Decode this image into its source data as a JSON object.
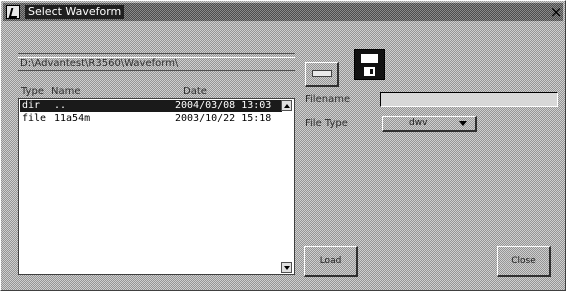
{
  "window": {
    "title": "Select Waveform",
    "close_glyph": "×"
  },
  "path": "D:\\Advantest\\R3560\\Waveform\\",
  "file_list": {
    "columns": [
      "Type",
      "Name",
      "Date"
    ],
    "rows": [
      {
        "type": "dir",
        "name": "..",
        "date": "2004/03/08 13:03",
        "selected": true
      },
      {
        "type": "file",
        "name": "11a54m",
        "date": "2003/10/22 15:18",
        "selected": false
      }
    ]
  },
  "icons": {
    "up_folder": "up-folder-icon",
    "save": "floppy-disk-icon",
    "scroll_up": "scroll-up-arrow-icon",
    "scroll_down": "scroll-down-arrow-icon"
  },
  "filename": {
    "label": "Filename",
    "value": ""
  },
  "filetype": {
    "label": "File Type",
    "value": "dwv"
  },
  "buttons": {
    "load": "Load",
    "close": "Close"
  },
  "colors": {
    "selection": "#1a1a1a",
    "list_background": "#ffffff"
  }
}
